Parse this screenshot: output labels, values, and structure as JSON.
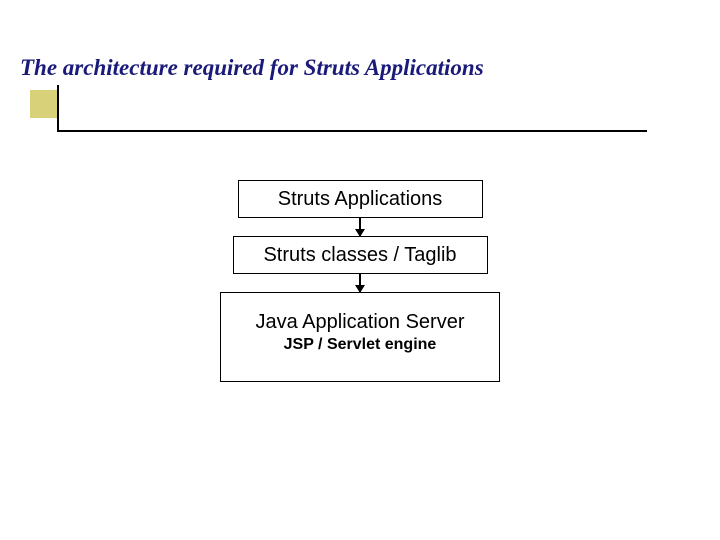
{
  "title": "The architecture required for Struts Applications",
  "boxes": {
    "top": "Struts Applications",
    "middle": "Struts classes / Taglib",
    "bottom_line1": "Java Application Server",
    "bottom_line2": "JSP / Servlet engine"
  }
}
